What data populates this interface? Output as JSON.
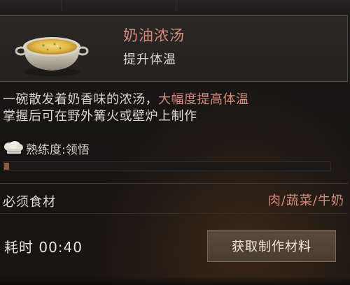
{
  "recipe": {
    "name": "奶油浓汤",
    "subtitle": "提升体温",
    "thumb_icon": "cream-soup-bowl-icon"
  },
  "description": {
    "line1_normal": "一碗散发着奶香味的浓汤，",
    "line1_highlight": "大幅度提高体温",
    "line2": "掌握后可在野外篝火或壁炉上制作"
  },
  "proficiency": {
    "icon": "chef-hat-icon",
    "label": "熟练度: ",
    "value": "领悟",
    "progress_fraction": 0.015
  },
  "ingredients": {
    "label": "必须食材",
    "values": "肉/蔬菜/牛奶"
  },
  "time": {
    "label": "耗时 00:40"
  },
  "action": {
    "button_label": "获取制作材料"
  },
  "colors": {
    "accent": "#d58a7b",
    "text": "#d6d2cc",
    "progress": "#8a5a3e",
    "button": "#4b3c31"
  }
}
